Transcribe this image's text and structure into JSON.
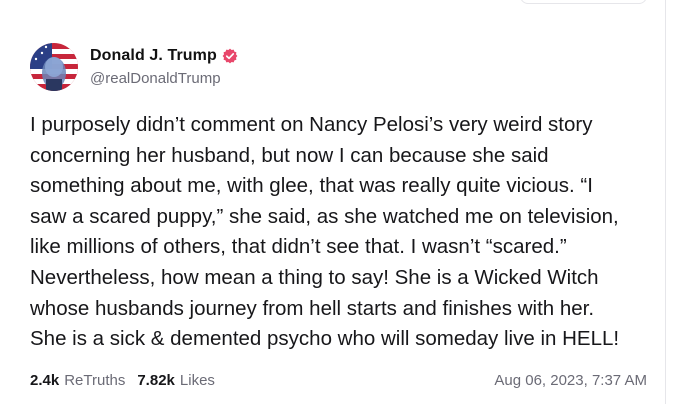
{
  "post": {
    "display_name": "Donald J. Trump",
    "handle": "@realDonaldTrump",
    "body": "I purposely didn’t comment on Nancy Pelosi’s very weird story\nconcerning her husband, but now I can because she said\nsomething about me, with glee, that was really quite vicious. “I\nsaw a scared puppy,” she said, as she watched me on television,\nlike millions of others,  that didn’t see that. I wasn’t “scared.”\nNevertheless, how mean a thing to say! She is a Wicked Witch\nwhose husbands journey from hell starts and finishes with her.\nShe is a sick & demented psycho who will someday live in HELL!",
    "retruths_count": "2.4k",
    "retruths_label": "ReTruths",
    "likes_count": "7.82k",
    "likes_label": "Likes",
    "timestamp": "Aug 06, 2023, 7:37 AM"
  },
  "icons": {
    "verified": "verified-badge-icon",
    "avatar": "profile-avatar"
  },
  "colors": {
    "verified_badge": "#e8476b",
    "muted_text": "#6b6b76",
    "primary_text": "#17171a"
  }
}
